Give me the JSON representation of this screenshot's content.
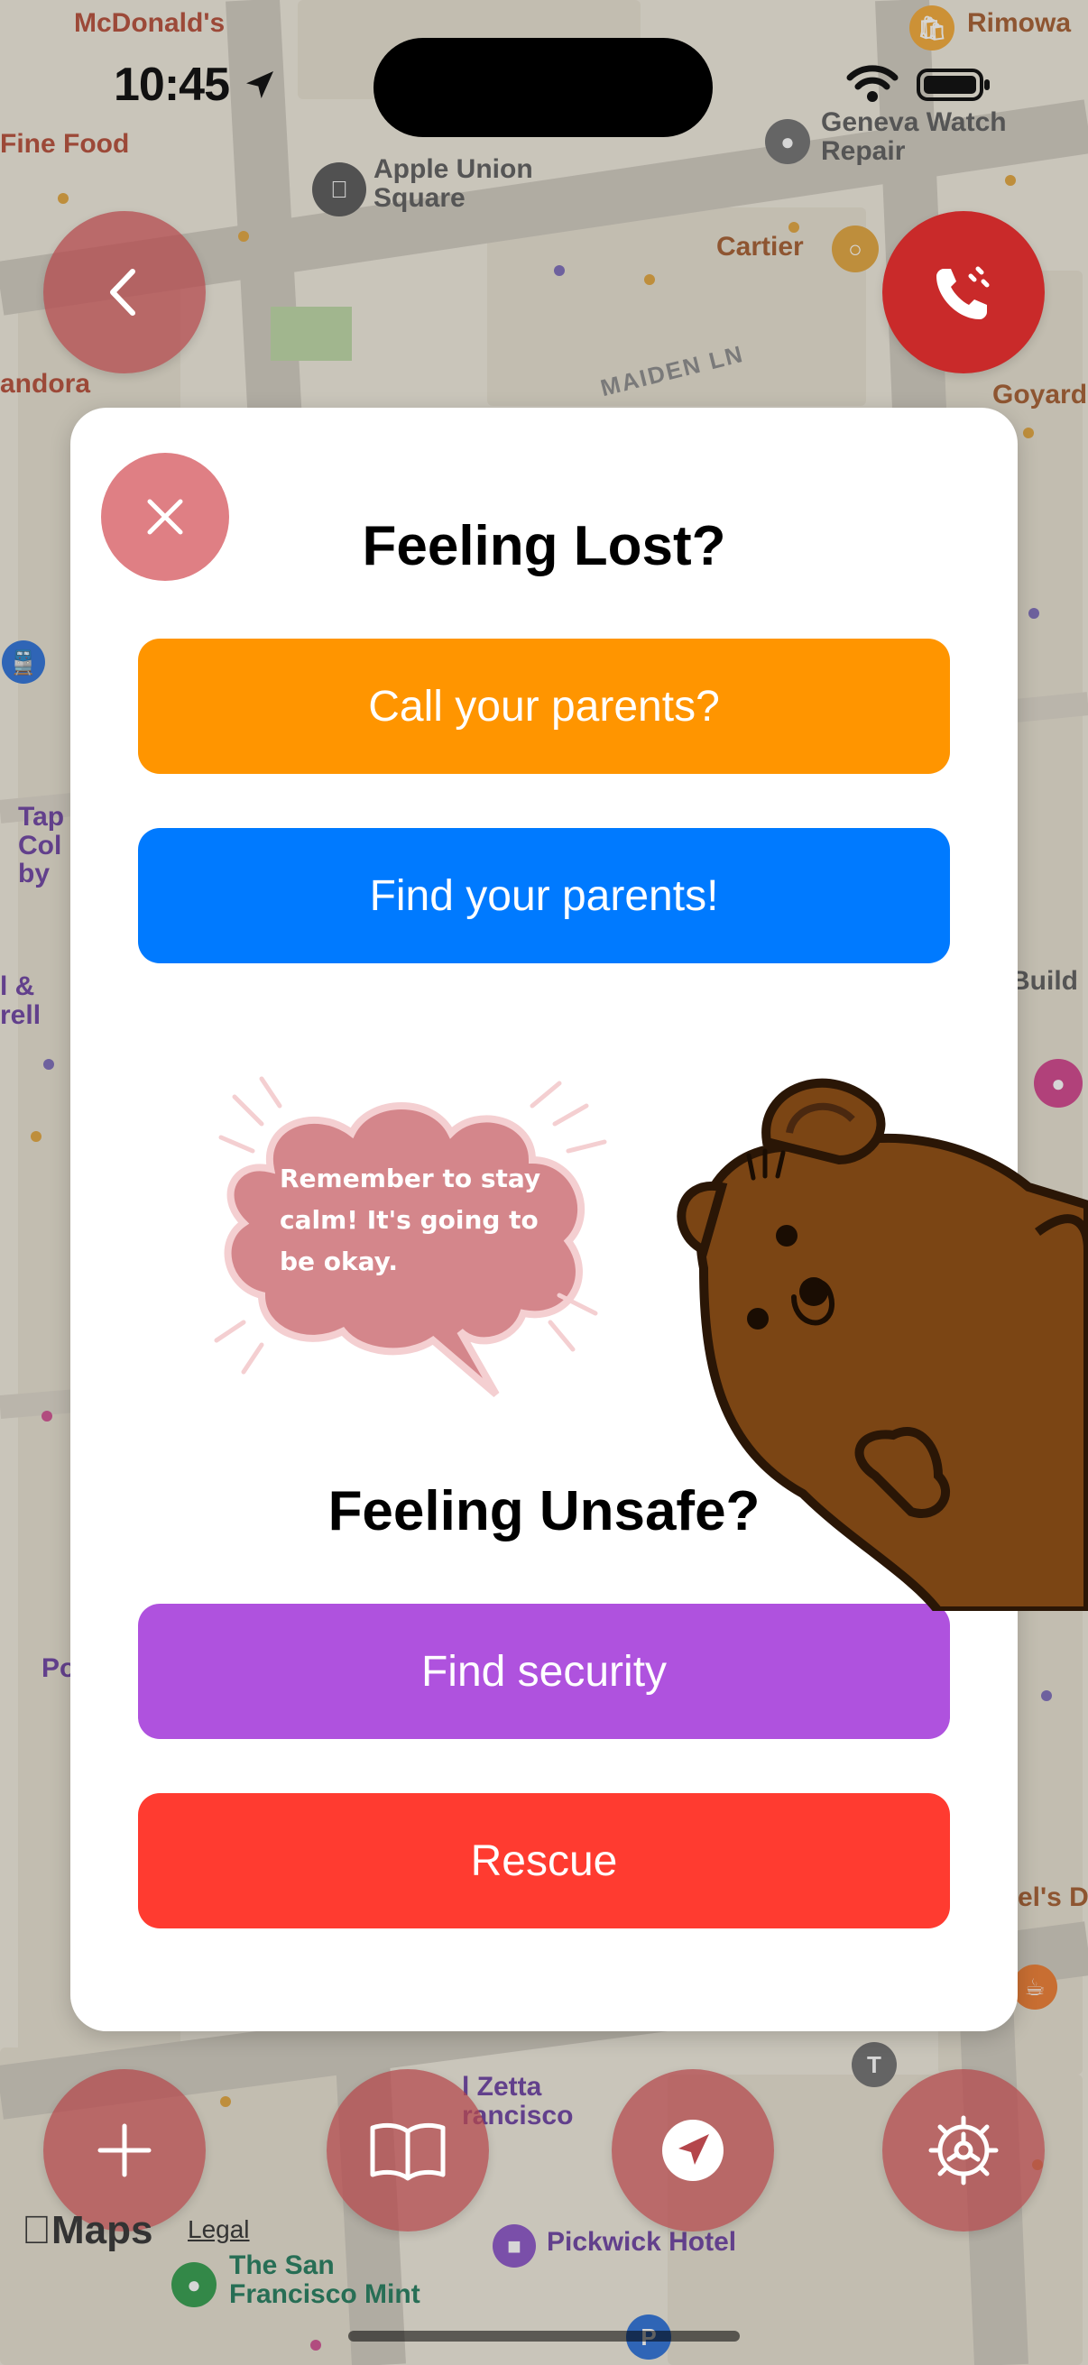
{
  "status_bar": {
    "time": "10:45"
  },
  "map": {
    "labels": {
      "mcdonalds": "McDonald's",
      "rimowa": "Rimowa",
      "fine_food": "Fine Food",
      "geneva_watch_repair": "Geneva Watch\nRepair",
      "apple_union_square": "Apple Union\nSquare",
      "cartier": "Cartier",
      "maiden_ln": "MAIDEN LN",
      "pandora": "andora",
      "goyard": "Goyard",
      "tap_col": "Tap\nCol\nby",
      "rell": "l &\nrell",
      "build": "Build",
      "po": "Po",
      "els_d": "el's D",
      "zetta": "l Zetta\nrancisco",
      "pickwick_hotel": "Pickwick Hotel",
      "sf_mint": "The San\nFrancisco Mint",
      "maps": "Maps",
      "legal": "Legal"
    }
  },
  "modal": {
    "feeling_lost_heading": "Feeling Lost?",
    "call_parents_label": "Call your parents?",
    "find_parents_label": "Find your parents!",
    "bubble_text": "Remember to stay calm! It's going to be okay.",
    "feeling_unsafe_heading": "Feeling Unsafe?",
    "find_security_label": "Find security",
    "rescue_label": "Rescue"
  },
  "colors": {
    "call_parents": "#ff9500",
    "find_parents": "#007aff",
    "find_security": "#af52de",
    "rescue": "#ff3b30",
    "close_button": "#df7f84",
    "round_buttons": "#b4464b",
    "call_button": "#c92a2a"
  },
  "icons": {
    "back": "chevron-left-icon",
    "call": "phone-icon",
    "close": "close-icon",
    "add": "plus-icon",
    "book": "book-icon",
    "locate": "location-arrow-icon",
    "settings": "gear-icon"
  }
}
